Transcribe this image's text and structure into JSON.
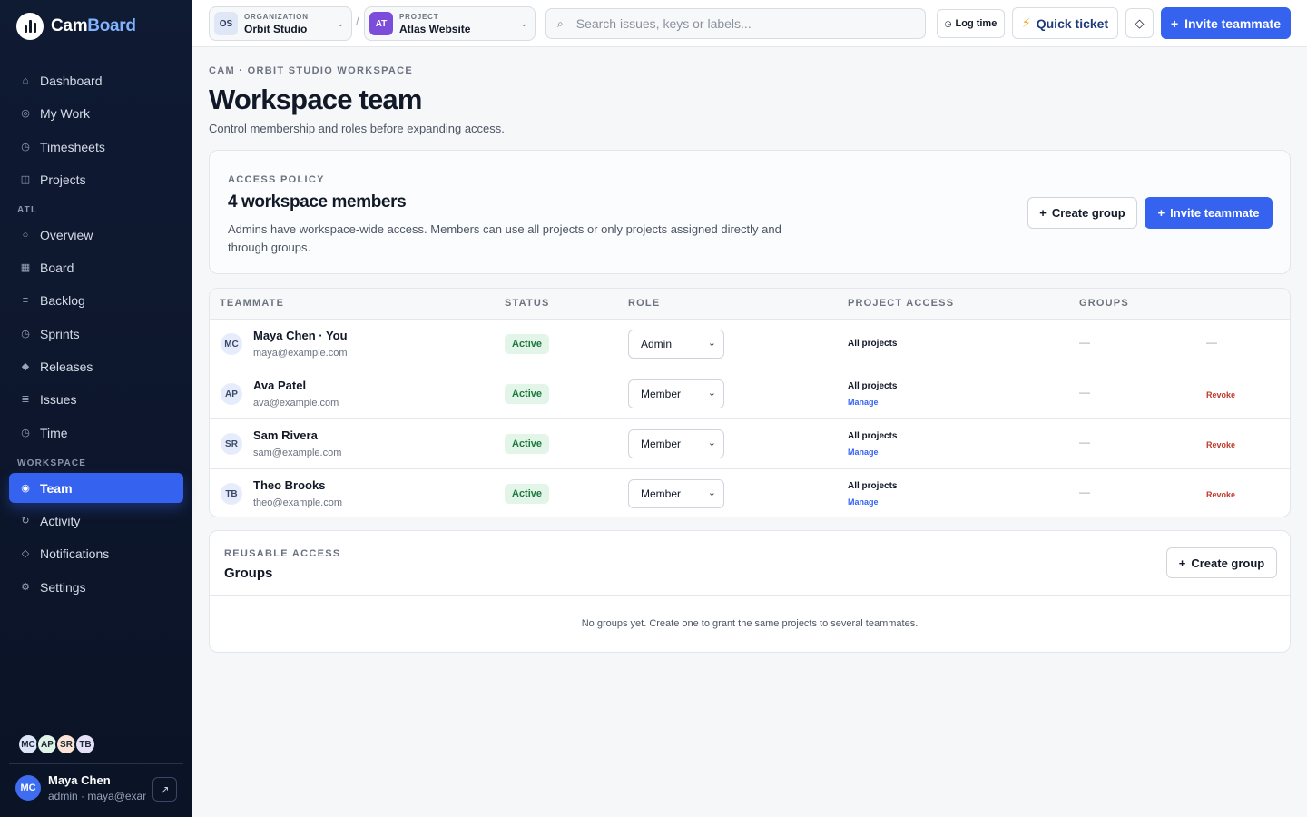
{
  "app": {
    "name_prefix": "Cam",
    "name_suffix": "Board"
  },
  "sidebar": {
    "items": [
      {
        "label": "Dashboard",
        "icon": "home-icon",
        "glyph": "⌂"
      },
      {
        "label": "My Work",
        "icon": "target-icon",
        "glyph": "◎"
      },
      {
        "label": "Timesheets",
        "icon": "clock-icon",
        "glyph": "◷"
      },
      {
        "label": "Projects",
        "icon": "folder-icon",
        "glyph": "◫"
      }
    ],
    "section_atl": "ATL",
    "atl_items": [
      {
        "label": "Overview",
        "icon": "overview-icon",
        "glyph": "○"
      },
      {
        "label": "Board",
        "icon": "board-icon",
        "glyph": "▦"
      },
      {
        "label": "Backlog",
        "icon": "backlog-icon",
        "glyph": "≡"
      },
      {
        "label": "Sprints",
        "icon": "sprint-icon",
        "glyph": "◷"
      },
      {
        "label": "Releases",
        "icon": "release-icon",
        "glyph": "◆"
      },
      {
        "label": "Issues",
        "icon": "issues-icon",
        "glyph": "≣"
      },
      {
        "label": "Time",
        "icon": "time-icon",
        "glyph": "◷"
      }
    ],
    "section_workspace": "WORKSPACE",
    "workspace_items": [
      {
        "label": "Team",
        "icon": "team-icon",
        "glyph": "◉",
        "active": true
      },
      {
        "label": "Activity",
        "icon": "activity-icon",
        "glyph": "↻"
      },
      {
        "label": "Notifications",
        "icon": "bell-icon",
        "glyph": "◇"
      },
      {
        "label": "Settings",
        "icon": "gear-icon",
        "glyph": "⚙"
      }
    ],
    "avatars": [
      {
        "initials": "MC",
        "color": "#dbe6fb"
      },
      {
        "initials": "AP",
        "color": "#dff3e6"
      },
      {
        "initials": "SR",
        "color": "#fbe3d6"
      },
      {
        "initials": "TB",
        "color": "#e4e0f7"
      }
    ],
    "user": {
      "initials": "MC",
      "name": "Maya Chen",
      "meta": "admin · maya@example.com"
    }
  },
  "topbar": {
    "org": {
      "badge": "OS",
      "label": "ORGANIZATION",
      "value": "Orbit Studio"
    },
    "project": {
      "badge": "AT",
      "label": "PROJECT",
      "value": "Atlas Website"
    },
    "separator": "/",
    "search_placeholder": "Search issues, keys or labels...",
    "log_time": "Log time",
    "quick_ticket": "Quick ticket",
    "invite": "Invite teammate"
  },
  "page": {
    "eyebrow": "CAM · ORBIT STUDIO WORKSPACE",
    "title": "Workspace team",
    "subtitle": "Control membership and roles before expanding access."
  },
  "policy": {
    "eyebrow": "ACCESS POLICY",
    "title": "4 workspace members",
    "description": "Admins have workspace-wide access. Members can use all projects or only projects assigned directly and through groups.",
    "create_group": "Create group",
    "invite": "Invite teammate"
  },
  "table": {
    "headers": {
      "teammate": "TEAMMATE",
      "status": "STATUS",
      "role": "ROLE",
      "access": "PROJECT ACCESS",
      "groups": "GROUPS"
    },
    "rows": [
      {
        "initials": "MC",
        "name": "Maya Chen · You",
        "email": "maya@example.com",
        "status": "Active",
        "role": "Admin",
        "access": "All projects",
        "manage": "",
        "groups": "—",
        "action": "—"
      },
      {
        "initials": "AP",
        "name": "Ava Patel",
        "email": "ava@example.com",
        "status": "Active",
        "role": "Member",
        "access": "All projects",
        "manage": "Manage",
        "groups": "—",
        "action": "Revoke"
      },
      {
        "initials": "SR",
        "name": "Sam Rivera",
        "email": "sam@example.com",
        "status": "Active",
        "role": "Member",
        "access": "All projects",
        "manage": "Manage",
        "groups": "—",
        "action": "Revoke"
      },
      {
        "initials": "TB",
        "name": "Theo Brooks",
        "email": "theo@example.com",
        "status": "Active",
        "role": "Member",
        "access": "All projects",
        "manage": "Manage",
        "groups": "—",
        "action": "Revoke"
      }
    ]
  },
  "groups": {
    "eyebrow": "REUSABLE ACCESS",
    "title": "Groups",
    "create_group": "Create group",
    "empty": "No groups yet. Create one to grant the same projects to several teammates."
  }
}
